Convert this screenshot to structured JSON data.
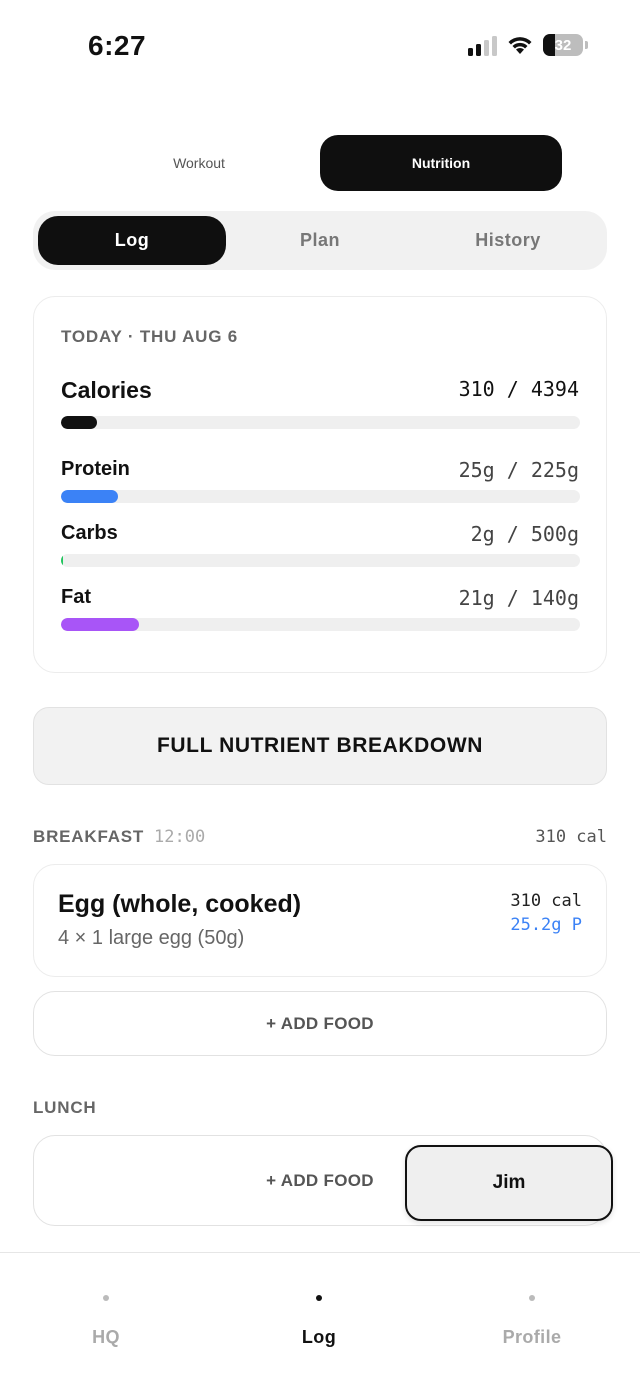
{
  "status_bar": {
    "time": "6:27",
    "battery": "32"
  },
  "mode_toggle": {
    "workout": "Workout",
    "nutrition": "Nutrition",
    "selected": "Nutrition"
  },
  "tabs": [
    {
      "label": "Log",
      "active": true
    },
    {
      "label": "Plan",
      "active": false
    },
    {
      "label": "History",
      "active": false
    }
  ],
  "summary": {
    "date_label": "TODAY · THU AUG 6",
    "macros": [
      {
        "name": "Calories",
        "value": "310 / 4394",
        "progress": 0.07,
        "color": "#111111"
      },
      {
        "name": "Protein",
        "value": "25g / 225g",
        "progress": 0.11,
        "color": "#3b82f6"
      },
      {
        "name": "Carbs",
        "value": "2g / 500g",
        "progress": 0.004,
        "color": "#22c55e"
      },
      {
        "name": "Fat",
        "value": "21g / 140g",
        "progress": 0.15,
        "color": "#a855f7"
      }
    ]
  },
  "breakdown_button": "FULL NUTRIENT BREAKDOWN",
  "meals": {
    "breakfast": {
      "title": "BREAKFAST",
      "time": "12:00",
      "calories": "310 cal",
      "items": [
        {
          "name": "Egg (whole, cooked)",
          "portion": "4 × 1 large egg (50g)",
          "calories": "310 cal",
          "protein": "25.2g P"
        }
      ],
      "add_label": "+ ADD FOOD"
    },
    "lunch": {
      "title": "LUNCH",
      "add_label": "+ ADD FOOD"
    }
  },
  "jim_button": "Jim",
  "nav": [
    {
      "label": "HQ",
      "active": false
    },
    {
      "label": "Log",
      "active": true
    },
    {
      "label": "Profile",
      "active": false
    }
  ]
}
